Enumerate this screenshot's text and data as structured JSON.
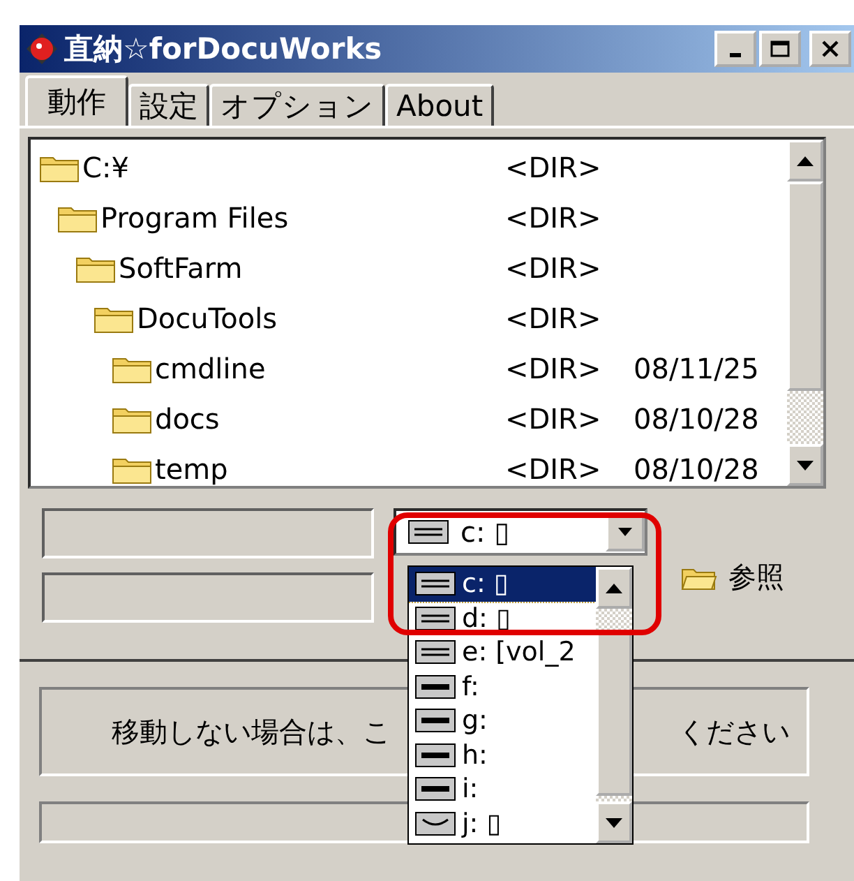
{
  "window": {
    "title": "直納☆forDocuWorks"
  },
  "tabs": [
    {
      "label": "動作",
      "selected": true
    },
    {
      "label": "設定",
      "selected": false
    },
    {
      "label": "オプション",
      "selected": false
    },
    {
      "label": "About",
      "selected": false
    }
  ],
  "file_list": {
    "items": [
      {
        "name": "C:¥",
        "type": "<DIR>",
        "children": [
          {
            "name": "Program Files",
            "type": "<DIR>",
            "children": [
              {
                "name": "SoftFarm",
                "type": "<DIR>",
                "children": [
                  {
                    "name": "DocuTools",
                    "type": "<DIR>",
                    "children": [
                      {
                        "name": "cmdline",
                        "type": "<DIR>",
                        "date": "08/11/25"
                      },
                      {
                        "name": "docs",
                        "type": "<DIR>",
                        "date": "08/10/28"
                      },
                      {
                        "name": "temp",
                        "type": "<DIR>",
                        "date": "08/10/28"
                      }
                    ]
                  }
                ]
              }
            ]
          }
        ]
      }
    ]
  },
  "drive_combo": {
    "value": "c: ▯",
    "items": [
      {
        "label": "c: ▯",
        "kind": "fixed",
        "selected": true
      },
      {
        "label": "d: ▯",
        "kind": "fixed",
        "selected": false
      },
      {
        "label": "e: [vol_2",
        "kind": "fixed",
        "selected": false
      },
      {
        "label": "f:",
        "kind": "removable",
        "selected": false
      },
      {
        "label": "g:",
        "kind": "removable",
        "selected": false
      },
      {
        "label": "h:",
        "kind": "removable",
        "selected": false
      },
      {
        "label": "i:",
        "kind": "removable",
        "selected": false
      },
      {
        "label": "j: ▯",
        "kind": "cdrom",
        "selected": false
      }
    ]
  },
  "browse_button": {
    "label": "参照"
  },
  "message": {
    "left": "移動しない場合は、こ",
    "right": "ください"
  }
}
